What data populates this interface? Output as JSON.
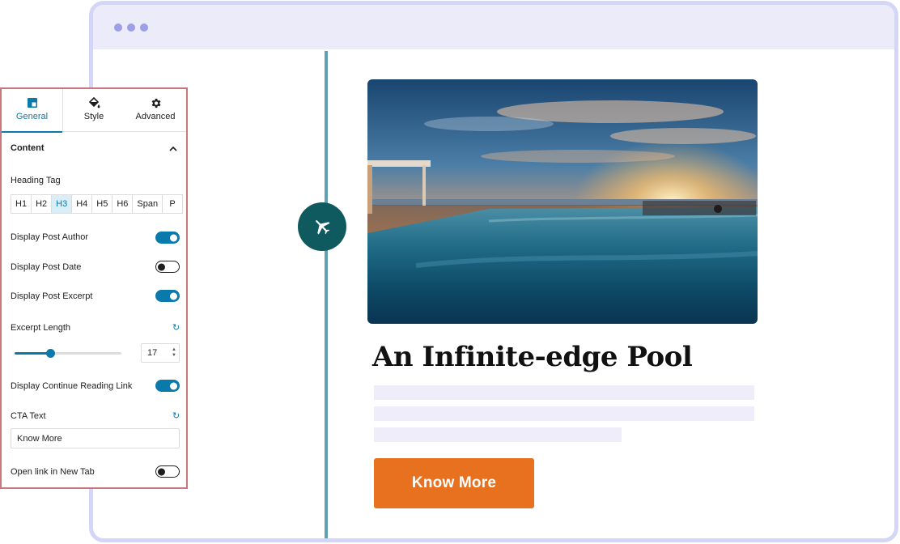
{
  "panel": {
    "tabs": [
      {
        "label": "General",
        "icon": "layout-icon",
        "active": true
      },
      {
        "label": "Style",
        "icon": "paint-bucket-icon",
        "active": false
      },
      {
        "label": "Advanced",
        "icon": "gear-icon",
        "active": false
      }
    ],
    "section_title": "Content",
    "heading_tag_label": "Heading Tag",
    "heading_tags": [
      "H1",
      "H2",
      "H3",
      "H4",
      "H5",
      "H6",
      "Span",
      "P"
    ],
    "heading_tag_selected": "H3",
    "display_post_author": {
      "label": "Display Post Author",
      "on": true
    },
    "display_post_date": {
      "label": "Display Post Date",
      "on": false
    },
    "display_post_excerpt": {
      "label": "Display Post Excerpt",
      "on": true
    },
    "excerpt_length": {
      "label": "Excerpt Length",
      "value": "17",
      "slider_fraction": 0.33
    },
    "display_continue_reading": {
      "label": "Display Continue Reading Link",
      "on": true
    },
    "cta_text": {
      "label": "CTA Text",
      "value": "Know More"
    },
    "open_new_tab": {
      "label": "Open link in New Tab",
      "on": false
    }
  },
  "preview": {
    "post_title": "An Infinite-edge Pool",
    "cta_label": "Know More",
    "timeline_icon": "airplane-icon"
  },
  "colors": {
    "accent_blue": "#0a7aad",
    "cta_orange": "#e7711f",
    "timeline_teal": "#0f5a5e",
    "frame_lavender": "#d3d6f7",
    "panel_border": "#c9767c"
  }
}
